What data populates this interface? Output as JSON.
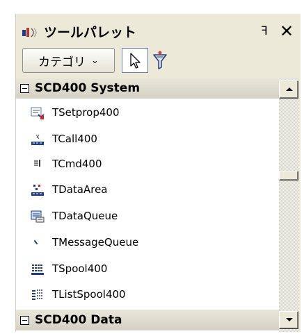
{
  "palette": {
    "title": "ツールパレット",
    "title_icon": "tool-palette-icon",
    "pin_label": "ꟻ",
    "close_label": "✕"
  },
  "toolbar": {
    "category_label": "カテゴリ",
    "category_chevron": "⌄",
    "pointer_icon": "pointer-arrow-icon",
    "filter_icon": "filter-funnel-icon"
  },
  "categories": [
    {
      "name": "SCD400 System",
      "items": [
        {
          "label": "TSetprop400",
          "icon": "setprop-icon"
        },
        {
          "label": "TCall400",
          "icon": "call-icon"
        },
        {
          "label": "TCmd400",
          "icon": "cmd-icon"
        },
        {
          "label": "TDataArea",
          "icon": "data-area-icon"
        },
        {
          "label": "TDataQueue",
          "icon": "data-queue-icon"
        },
        {
          "label": "TMessageQueue",
          "icon": "message-queue-icon"
        },
        {
          "label": "TSpool400",
          "icon": "spool-icon"
        },
        {
          "label": "TListSpool400",
          "icon": "list-spool-icon"
        }
      ]
    },
    {
      "name": "SCD400 Data",
      "items": []
    }
  ]
}
